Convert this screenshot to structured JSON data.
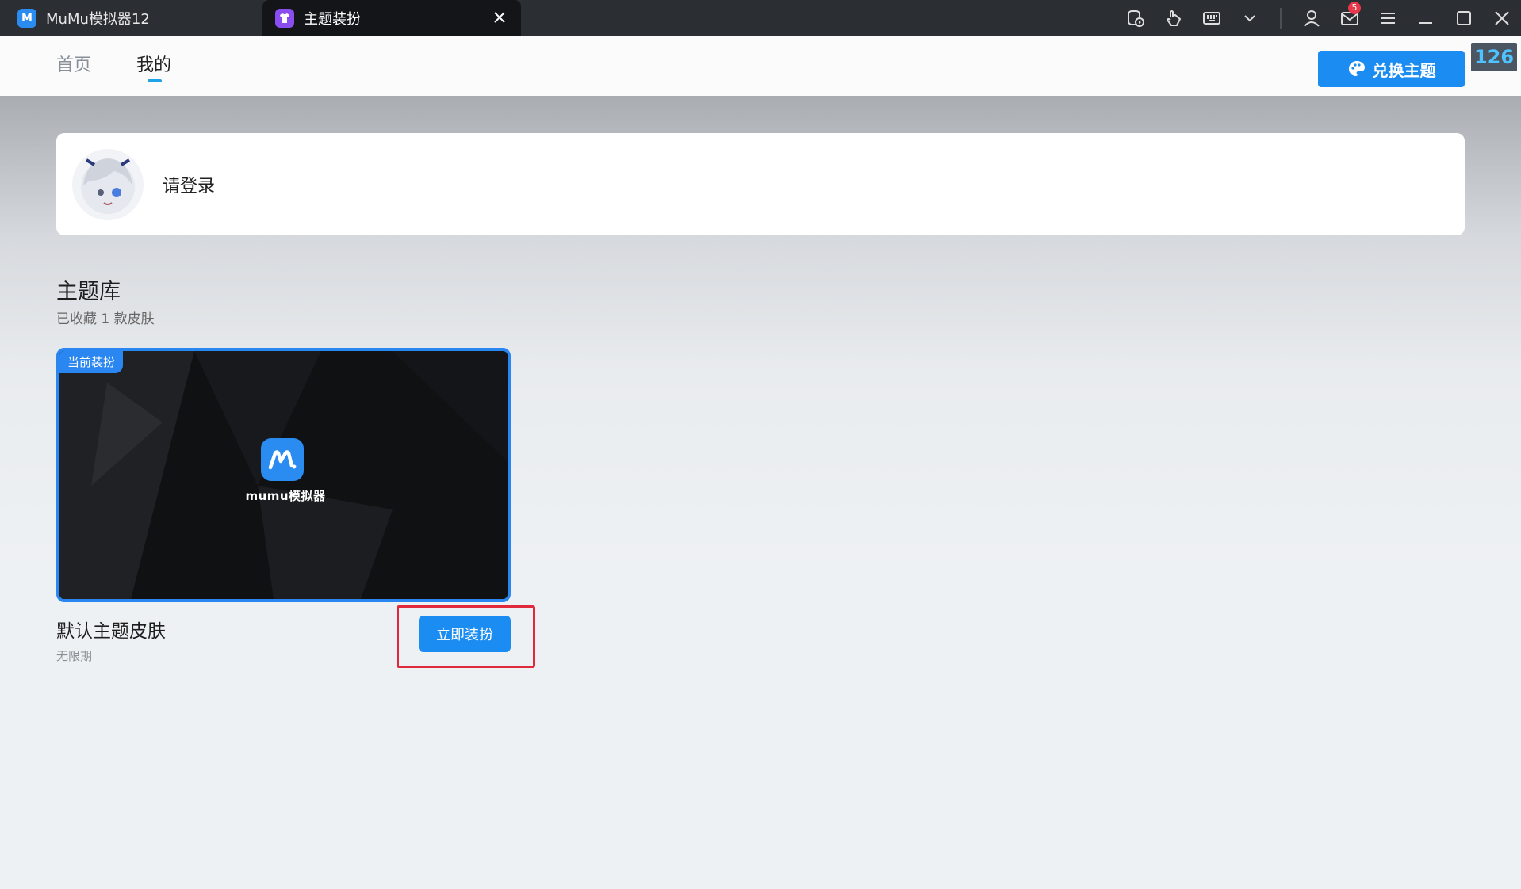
{
  "titlebar": {
    "app_tab_label": "MuMu模拟器12",
    "active_tab_label": "主题装扮",
    "mail_badge_count": "5"
  },
  "nav": {
    "home_label": "首页",
    "mine_label": "我的",
    "redeem_label": "兑换主题",
    "counter": "126"
  },
  "login": {
    "prompt": "请登录"
  },
  "library": {
    "title": "主题库",
    "subtitle": "已收藏 1 款皮肤",
    "theme": {
      "badge": "当前装扮",
      "brand": "mumu模拟器",
      "name": "默认主题皮肤",
      "expiry": "无限期",
      "apply_label": "立即装扮"
    }
  },
  "colors": {
    "accent": "#1b8cf2",
    "titlebar": "#2b2e33",
    "highlight": "#e02a3c"
  }
}
